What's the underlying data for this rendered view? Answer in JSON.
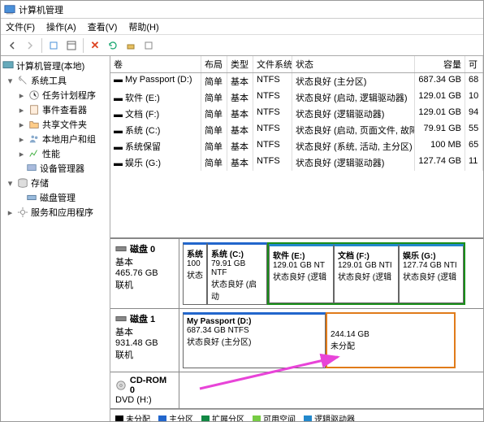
{
  "title": "计算机管理",
  "menu": {
    "file": "文件(F)",
    "action": "操作(A)",
    "view": "查看(V)",
    "help": "帮助(H)"
  },
  "tree": {
    "root": "计算机管理(本地)",
    "systools": "系统工具",
    "sched": "任务计划程序",
    "event": "事件查看器",
    "shared": "共享文件夹",
    "users": "本地用户和组",
    "perf": "性能",
    "devmgr": "设备管理器",
    "storage": "存储",
    "diskmgmt": "磁盘管理",
    "services": "服务和应用程序"
  },
  "cols": {
    "vol": "卷",
    "layout": "布局",
    "type": "类型",
    "fs": "文件系统",
    "status": "状态",
    "cap": "容量",
    "avail": "可"
  },
  "vols": [
    {
      "n": "My Passport (D:)",
      "l": "简单",
      "t": "基本",
      "f": "NTFS",
      "s": "状态良好 (主分区)",
      "c": "687.34 GB",
      "a": "68"
    },
    {
      "n": "软件 (E:)",
      "l": "简单",
      "t": "基本",
      "f": "NTFS",
      "s": "状态良好 (启动, 逻辑驱动器)",
      "c": "129.01 GB",
      "a": "10"
    },
    {
      "n": "文档 (F:)",
      "l": "简单",
      "t": "基本",
      "f": "NTFS",
      "s": "状态良好 (逻辑驱动器)",
      "c": "129.01 GB",
      "a": "94"
    },
    {
      "n": "系统 (C:)",
      "l": "简单",
      "t": "基本",
      "f": "NTFS",
      "s": "状态良好 (启动, 页面文件, 故障转储, 主分区)",
      "c": "79.91 GB",
      "a": "55"
    },
    {
      "n": "系统保留",
      "l": "简单",
      "t": "基本",
      "f": "NTFS",
      "s": "状态良好 (系统, 活动, 主分区)",
      "c": "100 MB",
      "a": "65"
    },
    {
      "n": "娱乐 (G:)",
      "l": "简单",
      "t": "基本",
      "f": "NTFS",
      "s": "状态良好 (逻辑驱动器)",
      "c": "127.74 GB",
      "a": "11"
    }
  ],
  "disk0": {
    "label": "磁盘 0",
    "type": "基本",
    "size": "465.76 GB",
    "state": "联机",
    "p1": {
      "n": "系统",
      "sz": "100",
      "st": "状态"
    },
    "p2": {
      "n": "系统 (C:)",
      "sz": "79.91 GB NTF",
      "st": "状态良好 (启动"
    },
    "p3": {
      "n": "软件  (E:)",
      "sz": "129.01 GB NT",
      "st": "状态良好 (逻辑"
    },
    "p4": {
      "n": "文档  (F:)",
      "sz": "129.01 GB NTI",
      "st": "状态良好 (逻辑"
    },
    "p5": {
      "n": "娱乐  (G:)",
      "sz": "127.74 GB NTI",
      "st": "状态良好 (逻辑"
    }
  },
  "disk1": {
    "label": "磁盘 1",
    "type": "基本",
    "size": "931.48 GB",
    "state": "联机",
    "p1": {
      "n": "My Passport  (D:)",
      "sz": "687.34 GB NTFS",
      "st": "状态良好 (主分区)"
    },
    "p2": {
      "sz": "244.14 GB",
      "st": "未分配"
    }
  },
  "cd": {
    "label": "CD-ROM 0",
    "dev": "DVD (H:)"
  },
  "legend": {
    "unalloc": "未分配",
    "primary": "主分区",
    "ext": "扩展分区",
    "free": "可用空间",
    "logical": "逻辑驱动器"
  }
}
